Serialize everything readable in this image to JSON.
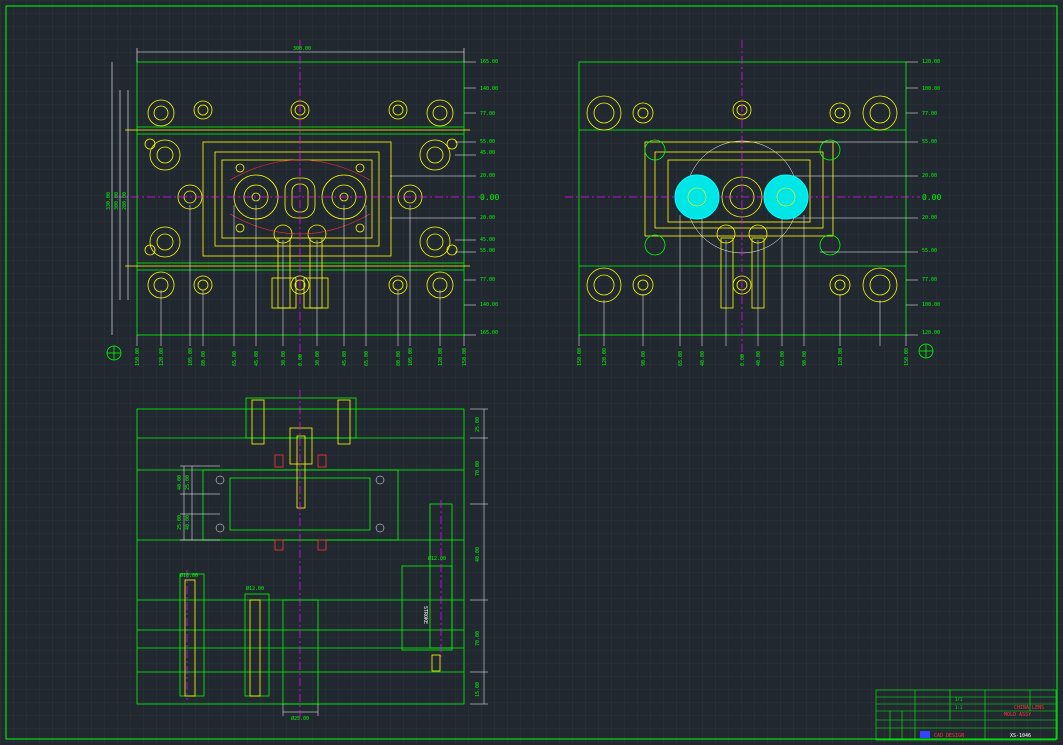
{
  "drawing": {
    "origin_label": "0.00",
    "top_left_view": {
      "width_dim": "300.00",
      "right_ordinates": [
        "165.00",
        "140.00",
        "77.00",
        "55.00",
        "45.00",
        "20.00",
        "0.00",
        "20.00",
        "45.00",
        "55.00",
        "77.00",
        "140.00",
        "165.00"
      ],
      "bottom_ordinates": [
        "150.00",
        "120.00",
        "105.00",
        "80.00",
        "65.00",
        "45.00",
        "30.00",
        "0.00",
        "30.00",
        "45.00",
        "65.00",
        "80.00",
        "105.00",
        "120.00",
        "150.00"
      ],
      "left_dims": [
        "330.00",
        "300.00",
        "280.00"
      ]
    },
    "top_right_view": {
      "right_ordinates": [
        "120.00",
        "100.00",
        "77.00",
        "55.00",
        "20.00",
        "0.00",
        "20.00",
        "55.00",
        "77.00",
        "100.00",
        "120.00"
      ],
      "bottom_ordinates": [
        "150.00",
        "120.00",
        "90.00",
        "65.00",
        "40.00",
        "0.00",
        "40.00",
        "65.00",
        "90.00",
        "120.00",
        "150.00"
      ]
    },
    "section_view": {
      "right_dims": [
        "25.00",
        "70.00",
        "40.00",
        "70.00",
        "15.00"
      ],
      "left_dims": [
        "40.00",
        "25.00",
        "25.00",
        "40.00"
      ],
      "bottom_dim": "Ø25.00",
      "pin_dims": [
        "Ø16.00",
        "Ø12.00",
        "Ø12.00"
      ],
      "stroke_label": "STROKE"
    },
    "title_block": {
      "customer": "CHINA LENS",
      "part_name": "MOLD ASSY",
      "company": "CAD DESIGN",
      "sheet": "1/1",
      "scale": "1:1",
      "drawing_no": "XS-1046"
    }
  },
  "colors": {
    "background": "#212830",
    "grid": "#2e3640",
    "line": "#00ff00",
    "highlight": "#ffff00",
    "centerline": "#ff00ff",
    "cavity": "#00ffff",
    "text": "#00ff00",
    "red": "#ff3333"
  }
}
